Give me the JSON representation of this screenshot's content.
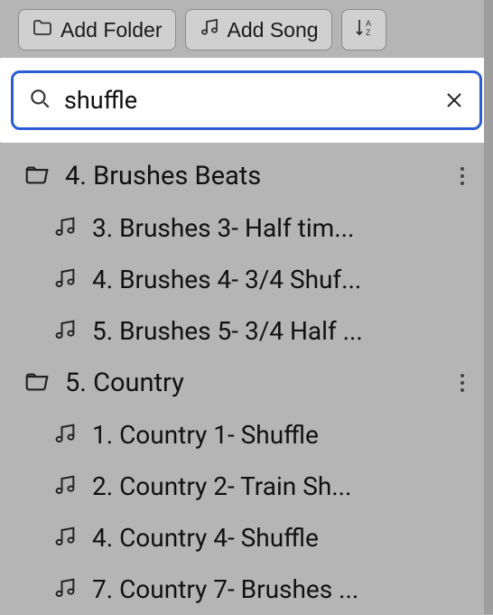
{
  "toolbar": {
    "add_folder_label": "Add Folder",
    "add_song_label": "Add Song"
  },
  "search": {
    "value": "shuffle"
  },
  "folders": [
    {
      "title": "4. Brushes Beats",
      "songs": [
        {
          "title": "3. Brushes 3- Half tim..."
        },
        {
          "title": "4. Brushes 4- 3/4 Shuf..."
        },
        {
          "title": "5. Brushes 5- 3/4 Half ..."
        }
      ]
    },
    {
      "title": "5. Country",
      "songs": [
        {
          "title": "1. Country 1- Shuffle"
        },
        {
          "title": "2. Country 2- Train Sh..."
        },
        {
          "title": "4. Country 4- Shuffle"
        },
        {
          "title": "7. Country 7- Brushes ..."
        }
      ]
    }
  ]
}
